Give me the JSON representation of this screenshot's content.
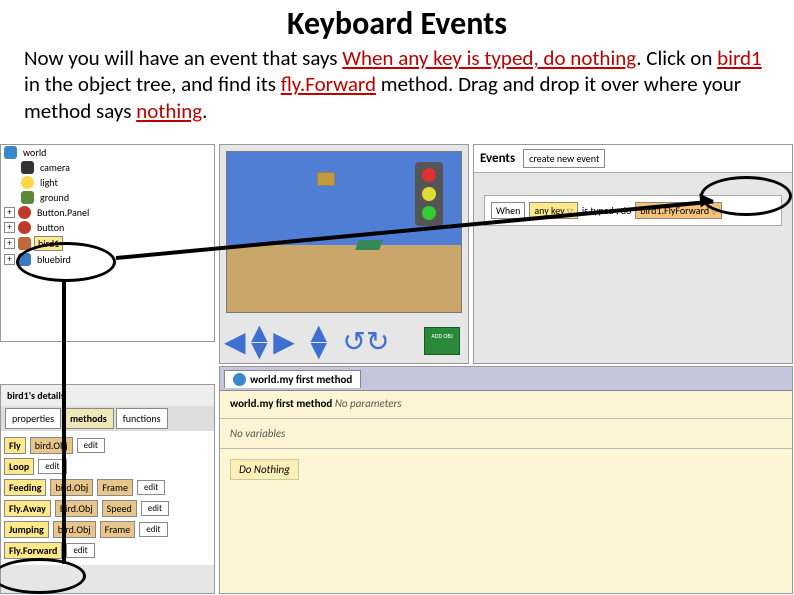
{
  "title": "Keyboard Events",
  "paragraph": {
    "p1": "Now you will have an event that says ",
    "red1": "When any key is typed, do nothing",
    "p2": ". Click on ",
    "red2": "bird1",
    "p3": " in the object tree, and find its ",
    "red3": "fly.Forward",
    "p4": " method. Drag and drop it over where your method says ",
    "red4": "nothing",
    "p5": "."
  },
  "tree": {
    "world": "world",
    "camera": "camera",
    "light": "light",
    "ground": "ground",
    "buttonPanel": "Button.Panel",
    "button": "button",
    "bird1": "bird1",
    "bluebird": "bluebird"
  },
  "scene": {
    "addBtn": "ADD OBJ"
  },
  "events": {
    "title": "Events",
    "createBtn": "create new event",
    "when": "When",
    "anykey": "any key",
    "istyped": "is typed , do",
    "target": "bird1.FlyForward"
  },
  "details": {
    "title": "bird1's details",
    "tabs": {
      "properties": "properties",
      "methods": "methods",
      "functions": "functions"
    },
    "methods": [
      {
        "name": "Fly",
        "params": [
          "bird.Obj"
        ],
        "edit": "edit"
      },
      {
        "name": "Loop",
        "params": [],
        "edit": "edit"
      },
      {
        "name": "Feeding",
        "params": [
          "bird.Obj",
          "Frame"
        ],
        "edit": "edit"
      },
      {
        "name": "Fly.Away",
        "params": [
          "bird.Obj",
          "Speed"
        ],
        "edit": "edit"
      },
      {
        "name": "Jumping",
        "params": [
          "bird.Obj",
          "Frame"
        ],
        "edit": "edit"
      },
      {
        "name": "Fly.Forward",
        "params": [],
        "edit": "edit"
      }
    ]
  },
  "editor": {
    "tab": "world.my first method",
    "sig": "world.my first method",
    "noparams": "No parameters",
    "novars": "No variables",
    "donothing": "Do Nothing"
  }
}
